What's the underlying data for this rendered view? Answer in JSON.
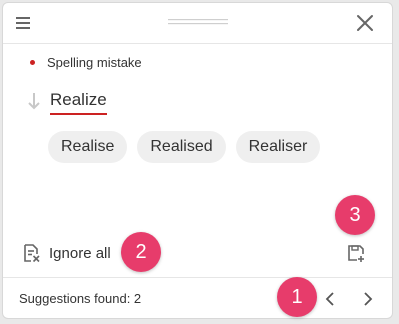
{
  "colors": {
    "accent_badge": "#e73c6b",
    "error_red": "#cc2222",
    "chip_bg": "#efefef",
    "text": "#333333",
    "icon": "#666666"
  },
  "header": {
    "menu_icon": "hamburger-menu-icon",
    "drag_icon": "drag-handle-icon",
    "close_icon": "close-icon"
  },
  "issue": {
    "type_label": "Spelling mistake",
    "original_word": "Realize"
  },
  "suggestions": [
    "Realise",
    "Realised",
    "Realiser"
  ],
  "actions": {
    "ignore_all_label": "Ignore all",
    "ignore_icon": "ignore-all-icon",
    "add_to_dictionary_icon": "add-to-dictionary-icon"
  },
  "footer": {
    "status_text": "Suggestions found: 2",
    "prev_icon": "chevron-left-icon",
    "next_icon": "chevron-right-icon"
  },
  "badges": [
    "1",
    "2",
    "3"
  ]
}
